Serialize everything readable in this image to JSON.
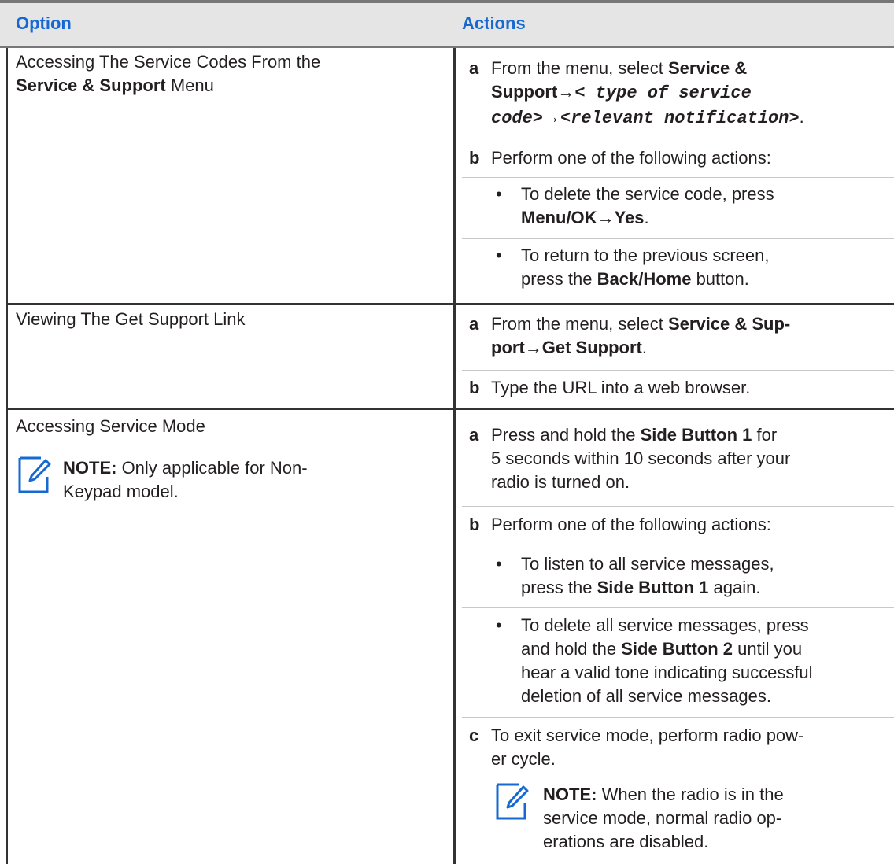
{
  "header": {
    "option": "Option",
    "actions": "Actions"
  },
  "row1": {
    "option_line1": "Accessing The Service Codes From the",
    "option_bold": "Service & Support",
    "option_tail": " Menu",
    "a_letter": "a",
    "a_pre": "From the menu, select ",
    "a_bold1": "Service &",
    "a_bold2": "Support",
    "a_arrow1": "→",
    "a_mono1": "< type of service",
    "a_mono2": "code>",
    "a_arrow2": "→",
    "a_mono3": "<relevant notification>",
    "a_end": ".",
    "b_letter": "b",
    "b_text": "Perform one of the following actions:",
    "bullet": "•",
    "b1_line1": "To delete the service code, press",
    "b1_bold": "Menu/OK",
    "b1_arrow": "→",
    "b1_bold2": "Yes",
    "b1_end": ".",
    "b2_line1": "To return to the previous screen,",
    "b2_pre": "press the ",
    "b2_bold": "Back/Home",
    "b2_tail": " button."
  },
  "row2": {
    "option": "Viewing The Get Support Link",
    "a_letter": "a",
    "a_pre": "From the menu, select ",
    "a_bold1": "Service & Sup-",
    "a_bold2": "port",
    "a_arrow": "→",
    "a_bold3": "Get Support",
    "a_end": ".",
    "b_letter": "b",
    "b_text": "Type the URL into a web browser."
  },
  "row3": {
    "option": "Accessing Service Mode",
    "note_label": "NOTE:",
    "note_line1": " Only applicable for Non-",
    "note_line2": "Keypad model.",
    "a_letter": "a",
    "a_pre": "Press and hold the ",
    "a_bold": "Side Button 1",
    "a_tail": " for",
    "a_line2": "5 seconds within 10 seconds after your",
    "a_line3": "radio is turned on.",
    "b_letter": "b",
    "b_text": "Perform one of the following actions:",
    "bullet": "•",
    "b1_line1": "To listen to all service messages,",
    "b1_pre": "press the ",
    "b1_bold": "Side Button 1",
    "b1_tail": " again.",
    "b2_line1": "To delete all service messages, press",
    "b2_pre": "and hold the ",
    "b2_bold": "Side Button 2",
    "b2_tail": " until you",
    "b2_line3": "hear a valid tone indicating successful",
    "b2_line4": "deletion of all service messages.",
    "c_letter": "c",
    "c_line1": "To exit service mode, perform radio pow-",
    "c_line2": "er cycle.",
    "c_note_label": "NOTE:",
    "c_note_line1": " When the radio is in the",
    "c_note_line2": "service mode, normal radio op-",
    "c_note_line3": "erations are disabled."
  },
  "colors": {
    "header_text": "#1769d1",
    "header_bg": "#e5e5e5",
    "note_icon": "#1769d1"
  },
  "icons": [
    "note-icon"
  ]
}
